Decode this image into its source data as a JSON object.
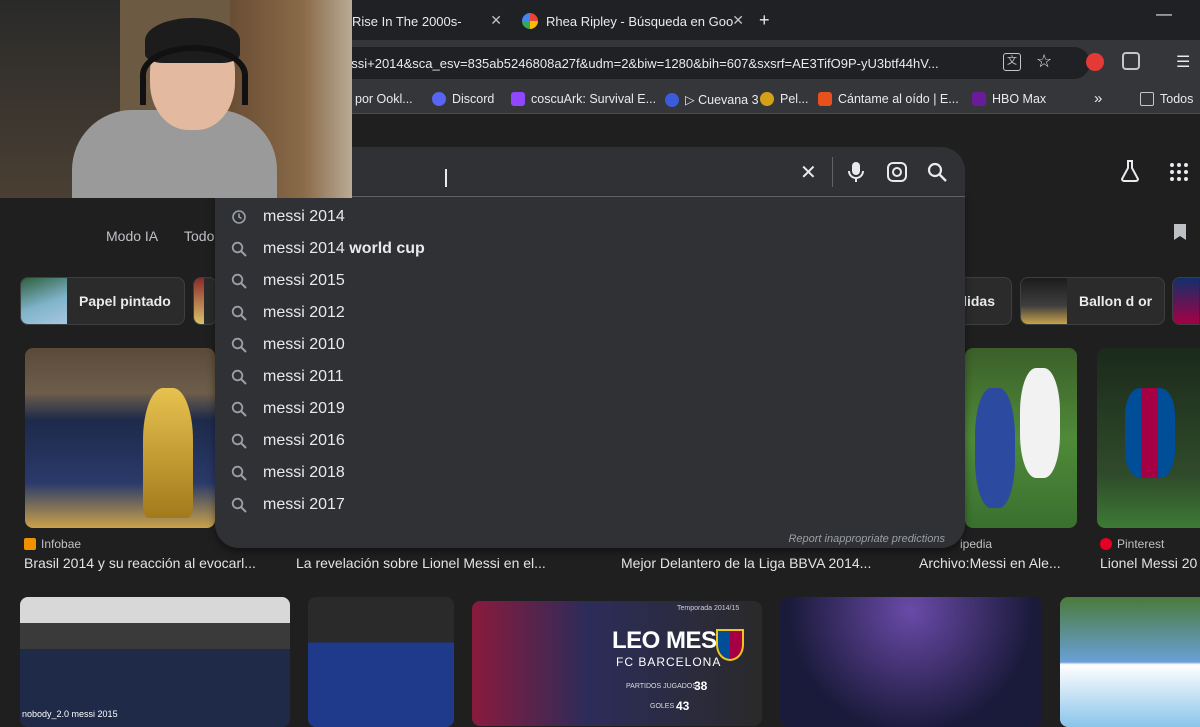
{
  "tabs": [
    {
      "title": "Rise In The 2000s-",
      "active": false
    },
    {
      "title": "Rhea Ripley - Búsqueda en Goo",
      "active": false
    }
  ],
  "new_tab_label": "+",
  "omnibox": {
    "url": "essi+2014&sca_esv=835ab5246808a27f&udm=2&biw=1280&bih=607&sxsrf=AE3TifO9P-yU3btf44hV..."
  },
  "bookmarks": [
    {
      "label": "por Ookl...",
      "color": "#1a73e8"
    },
    {
      "label": "Discord",
      "color": "#5865f2"
    },
    {
      "label": "coscuArk: Survival E...",
      "color": "#9146ff"
    },
    {
      "label": "▷ Cuevana 3",
      "color": "#3b5bdb"
    },
    {
      "label": "Pel...",
      "color": "#d4a017"
    },
    {
      "label": "Cántame al oído | E...",
      "color": "#e8501c"
    },
    {
      "label": "HBO Max",
      "color": "#6a1b9a"
    },
    {
      "label": "Todos",
      "color": "#9aa0a6"
    }
  ],
  "nav_tabs": [
    "Modo IA",
    "Todo"
  ],
  "chips": [
    {
      "label": "Papel pintado"
    },
    {
      "label": "lidas"
    },
    {
      "label": "Ballon d or"
    }
  ],
  "suggestions": [
    {
      "prefix": "messi 2014",
      "suffix": "",
      "icon": "history-icon"
    },
    {
      "prefix": "messi 2014",
      "suffix": " world cup",
      "icon": "search-icon"
    },
    {
      "prefix": "messi 2015",
      "suffix": "",
      "icon": "search-icon"
    },
    {
      "prefix": "messi 2012",
      "suffix": "",
      "icon": "search-icon"
    },
    {
      "prefix": "messi 2010",
      "suffix": "",
      "icon": "search-icon"
    },
    {
      "prefix": "messi 2011",
      "suffix": "",
      "icon": "search-icon"
    },
    {
      "prefix": "messi 2019",
      "suffix": "",
      "icon": "search-icon"
    },
    {
      "prefix": "messi 2016",
      "suffix": "",
      "icon": "search-icon"
    },
    {
      "prefix": "messi 2018",
      "suffix": "",
      "icon": "search-icon"
    },
    {
      "prefix": "messi 2017",
      "suffix": "",
      "icon": "search-icon"
    }
  ],
  "report_text": "Report inappropriate predictions",
  "results": [
    {
      "source": "Infobae",
      "caption": "Brasil 2014 y su reacción al evocarl..."
    },
    {
      "source": "",
      "caption": "La revelación sobre Lionel Messi en el..."
    },
    {
      "source": "",
      "caption": "Mejor Delantero de la Liga BBVA 2014..."
    },
    {
      "source": "ipedia",
      "caption": "Archivo:Messi en Ale..."
    },
    {
      "source": "Pinterest",
      "caption": "Lionel Messi 20"
    }
  ],
  "bottom_image": {
    "watermark": "nobody_2.0 messi 2015",
    "leo_title": "LEO MESSI",
    "leo_sub": "FC BARCELONA",
    "season": "Temporada 2014/15",
    "stats": [
      {
        "label": "PARTIDOS JUGADOS",
        "value": "38"
      },
      {
        "label": "GOLES",
        "value": "43"
      }
    ]
  },
  "colors": {
    "accent": "#8ab4f8",
    "barca_red": "#a50044",
    "barca_blue": "#004d98"
  }
}
